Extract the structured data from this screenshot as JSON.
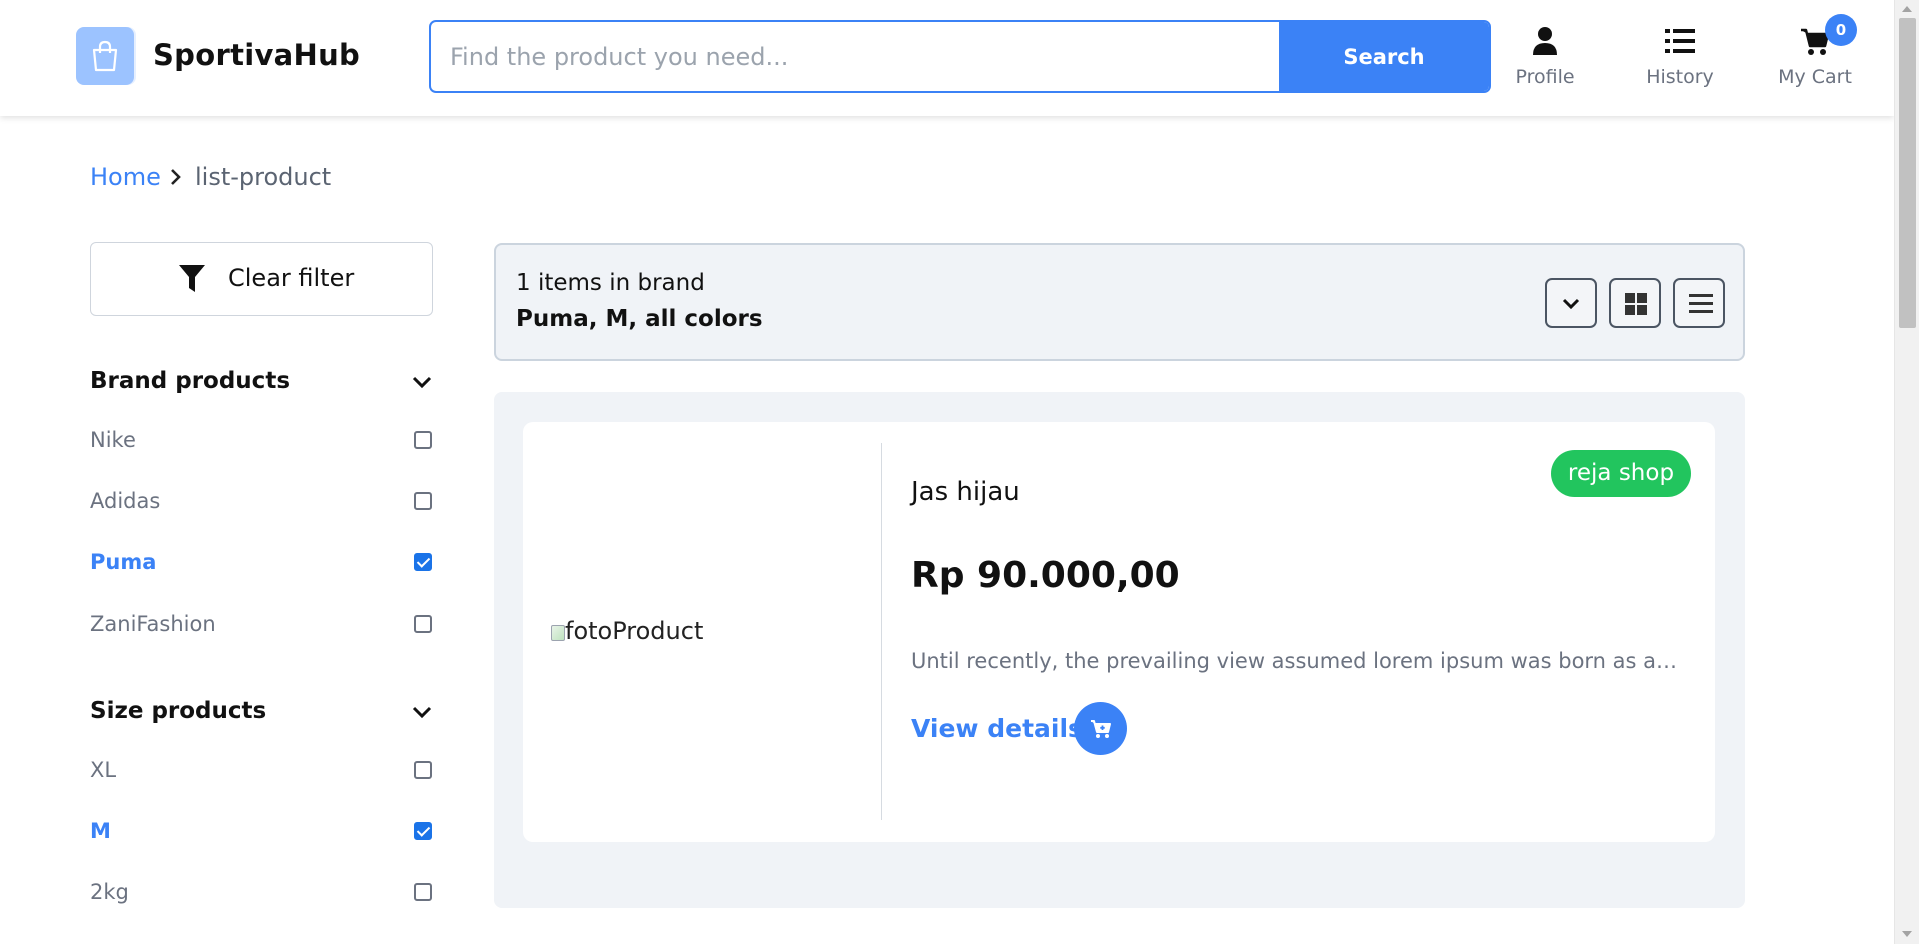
{
  "header": {
    "brand": "SportivaHub",
    "search_placeholder": "Find the product you need...",
    "search_button": "Search",
    "nav": [
      {
        "label": "Profile",
        "icon": "user-icon"
      },
      {
        "label": "History",
        "icon": "list-icon"
      },
      {
        "label": "My Cart",
        "icon": "cart-icon"
      }
    ],
    "cart_count": "0"
  },
  "breadcrumb": {
    "home": "Home",
    "current": "list-product"
  },
  "sidebar": {
    "clear_filter": "Clear filter",
    "brand_group": {
      "title": "Brand products",
      "options": [
        {
          "label": "Nike",
          "checked": false
        },
        {
          "label": "Adidas",
          "checked": false
        },
        {
          "label": "Puma",
          "checked": true
        },
        {
          "label": "ZaniFashion",
          "checked": false
        }
      ]
    },
    "size_group": {
      "title": "Size products",
      "options": [
        {
          "label": "XL",
          "checked": false
        },
        {
          "label": "M",
          "checked": true
        },
        {
          "label": "2kg",
          "checked": false
        }
      ]
    }
  },
  "results": {
    "count_text": "1 items in brand",
    "active_filters": "Puma, M, all colors"
  },
  "products": [
    {
      "image_alt": "fotoProduct",
      "shop": "reja shop",
      "name": "Jas hijau",
      "price": "Rp 90.000,00",
      "description": "Until recently, the prevailing view assumed lorem ipsum was born as a nonsense text.",
      "view_details": "View details"
    }
  ],
  "colors": {
    "accent": "#3b82f6",
    "shop_badge": "#22c55e",
    "panel_bg": "#f0f3f7"
  }
}
